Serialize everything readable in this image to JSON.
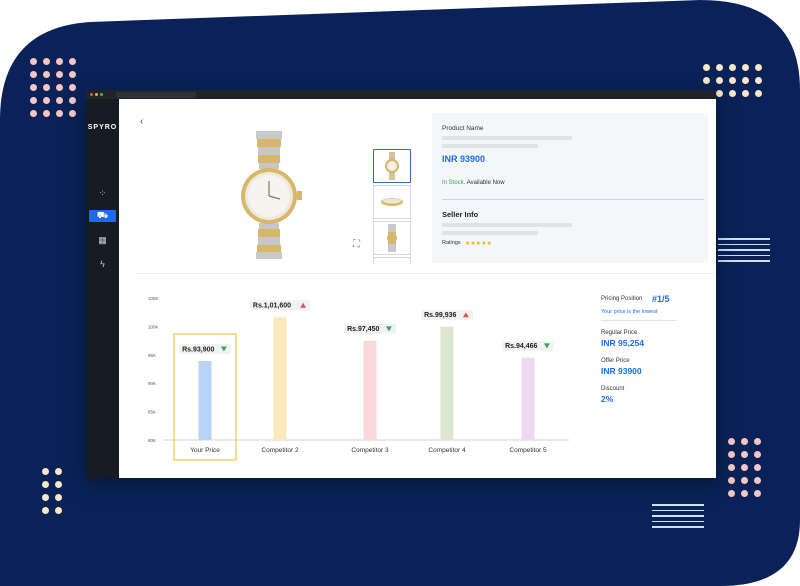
{
  "app": {
    "logo": "SPYRO"
  },
  "sidebar": {
    "items": [
      {
        "name": "dashboard-icon",
        "glyph": "⁘"
      },
      {
        "name": "products-icon",
        "glyph": "⛟"
      },
      {
        "name": "calculator-icon",
        "glyph": "▦"
      },
      {
        "name": "lightning-icon",
        "glyph": "ϟ"
      }
    ]
  },
  "product": {
    "back_glyph": "‹",
    "name_label": "Product Name",
    "price": "INR 93900",
    "stock_status": "In Stock",
    "availability": ". Available Now",
    "seller_label": "Seller Info",
    "ratings_label": "Ratings",
    "stars": "★★★★★",
    "expand_glyph": "⛶"
  },
  "chart_data": {
    "type": "bar",
    "categories": [
      "Your Price",
      "Competitor 2",
      "Competitor 3",
      "Competitor 4",
      "Competitor 5"
    ],
    "values": [
      93900,
      101600,
      97450,
      99936,
      94466
    ],
    "value_labels": [
      "Rs.93,900",
      "Rs.1,01,600",
      "Rs.97,450",
      "Rs.99,936",
      "Rs.94,466"
    ],
    "trend": [
      "down",
      "up",
      "down",
      "up",
      "down"
    ],
    "colors": [
      "#b9d3f6",
      "#fbe8bd",
      "#fbd9d9",
      "#dbe7cf",
      "#edd9f2"
    ],
    "highlight_color": "#f0c34a",
    "y_ticks": [
      "105K",
      "100K",
      "95K",
      "90K",
      "85K",
      "80K"
    ],
    "ylim": [
      80000,
      105000
    ],
    "highlight_index": 0
  },
  "pricing": {
    "position_label": "Pricing Position",
    "position_value": "#1/5",
    "note": "Your price is the lowest",
    "regular_label": "Regular Price",
    "regular_value": "INR 95,254",
    "offer_label": "Offer Price",
    "offer_value": "INR 93900",
    "discount_label": "Discount",
    "discount_value": "2%"
  },
  "colors": {
    "navy": "#0a2257",
    "accent_blue": "#1f6ae6",
    "dot_pink": "#f7c6c4",
    "dot_cream": "#f9e7c7",
    "arrow_up": "#e25555",
    "arrow_down": "#3aa858"
  }
}
